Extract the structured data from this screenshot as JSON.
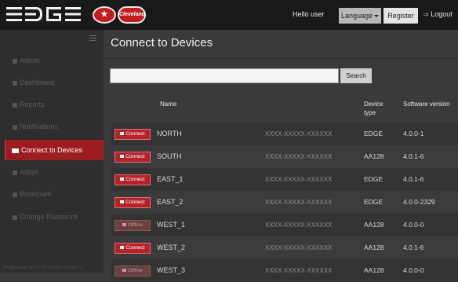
{
  "header": {
    "logo_text": "EDGE",
    "brand_badge_left": "",
    "brand_badge_right": "Cleveland",
    "greeting": "Hello user",
    "language_button": "Language",
    "register_button": "Register",
    "logout_link": "Logout"
  },
  "sidebar": {
    "items": [
      {
        "label": "Admin"
      },
      {
        "label": "Dashboard"
      },
      {
        "label": "Reports"
      },
      {
        "label": "Notifications"
      },
      {
        "label": "Connect to Devices"
      },
      {
        "label": "Adopt"
      },
      {
        "label": "Bookmark"
      },
      {
        "label": "Change Password"
      }
    ],
    "footer": "Welbilt Group, LLC © 2014-2018 | Version 1.1"
  },
  "main": {
    "title": "Connect to Devices",
    "search": {
      "value": "",
      "placeholder": "",
      "button": "Search"
    },
    "columns": {
      "name": "Name",
      "device_type": "Device type",
      "software_version": "Software version"
    },
    "rows": [
      {
        "action": "Connect",
        "name": "NORTH",
        "serial": "XXXX-XXXXX-XXXXXX",
        "type": "EDGE",
        "version": "4.0.0-1"
      },
      {
        "action": "Connect",
        "name": "SOUTH",
        "serial": "XXXX-XXXXX-XXXXXX",
        "type": "AA128",
        "version": "4.0.1-6"
      },
      {
        "action": "Connect",
        "name": "EAST_1",
        "serial": "XXXX-XXXXX-XXXXXX",
        "type": "EDGE",
        "version": "4.0.1-6"
      },
      {
        "action": "Connect",
        "name": "EAST_2",
        "serial": "XXXX-XXXXX-XXXXXX",
        "type": "EDGE",
        "version": "4.0.0-2329"
      },
      {
        "action": "Offline",
        "name": "WEST_1",
        "serial": "XXXX-XXXXX-XXXXXX",
        "type": "AA128",
        "version": "4.0.0-0"
      },
      {
        "action": "Connect",
        "name": "WEST_2",
        "serial": "XXXX-XXXXX-XXXXXX",
        "type": "AA128",
        "version": "4.0.1-6"
      },
      {
        "action": "Offline",
        "name": "WEST_3",
        "serial": "XXXX-XXXXX-XXXXXX",
        "type": "AA128",
        "version": "4.0.0-0"
      }
    ]
  },
  "colors": {
    "accent": "#9d1c20",
    "header_bg": "#191919",
    "sidebar_bg": "#2e2e2e",
    "main_bg": "#3a3a3a"
  }
}
